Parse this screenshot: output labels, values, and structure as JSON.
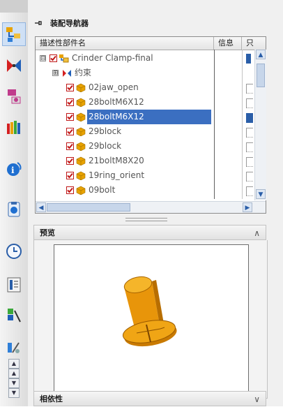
{
  "toolbar": {
    "items": [
      {
        "name": "assembly-navigator-icon",
        "active": true
      },
      {
        "name": "constraint-navigator-icon",
        "active": false
      },
      {
        "name": "part-navigator-icon",
        "active": false
      },
      {
        "name": "reuse-library-icon",
        "active": false
      },
      {
        "name": "web-browser-icon",
        "active": false
      },
      {
        "name": "process-studio-icon",
        "active": false
      },
      {
        "name": "history-icon",
        "active": false
      },
      {
        "name": "system-materials-icon",
        "active": false
      },
      {
        "name": "roles-icon",
        "active": false
      },
      {
        "name": "analysis-icon",
        "active": false
      }
    ],
    "mini_buttons": [
      "scroll-up",
      "scroll-up-2",
      "scroll-down",
      "scroll-down-2"
    ]
  },
  "navigator": {
    "title": "装配导航器",
    "columns": {
      "name": "描述性部件名",
      "info": "信息",
      "only": "只"
    },
    "rows": [
      {
        "label": "Crinder Clamp-final",
        "type": "assembly",
        "expander": "⊟",
        "checked": true
      },
      {
        "label": "约束",
        "type": "constraints",
        "expander": "⊞",
        "checked": false
      },
      {
        "label": "02jaw_open",
        "type": "part",
        "checked": true
      },
      {
        "label": "28boltM6X12",
        "type": "part",
        "checked": true
      },
      {
        "label": "28boltM6X12",
        "type": "part",
        "checked": true,
        "selected": true
      },
      {
        "label": "29block",
        "type": "part",
        "checked": true
      },
      {
        "label": "29block",
        "type": "part",
        "checked": true
      },
      {
        "label": "21boltM8X20",
        "type": "part",
        "checked": true
      },
      {
        "label": "19ring_orient",
        "type": "part",
        "checked": true
      },
      {
        "label": "09bolt",
        "type": "part",
        "checked": true
      }
    ]
  },
  "preview": {
    "title": "预览",
    "chevron": "∧"
  },
  "dependencies": {
    "title": "相依性",
    "chevron": "∨"
  },
  "colors": {
    "selection": "#3b6fc1",
    "check_red": "#d42020",
    "part_orange": "#e8a200"
  }
}
